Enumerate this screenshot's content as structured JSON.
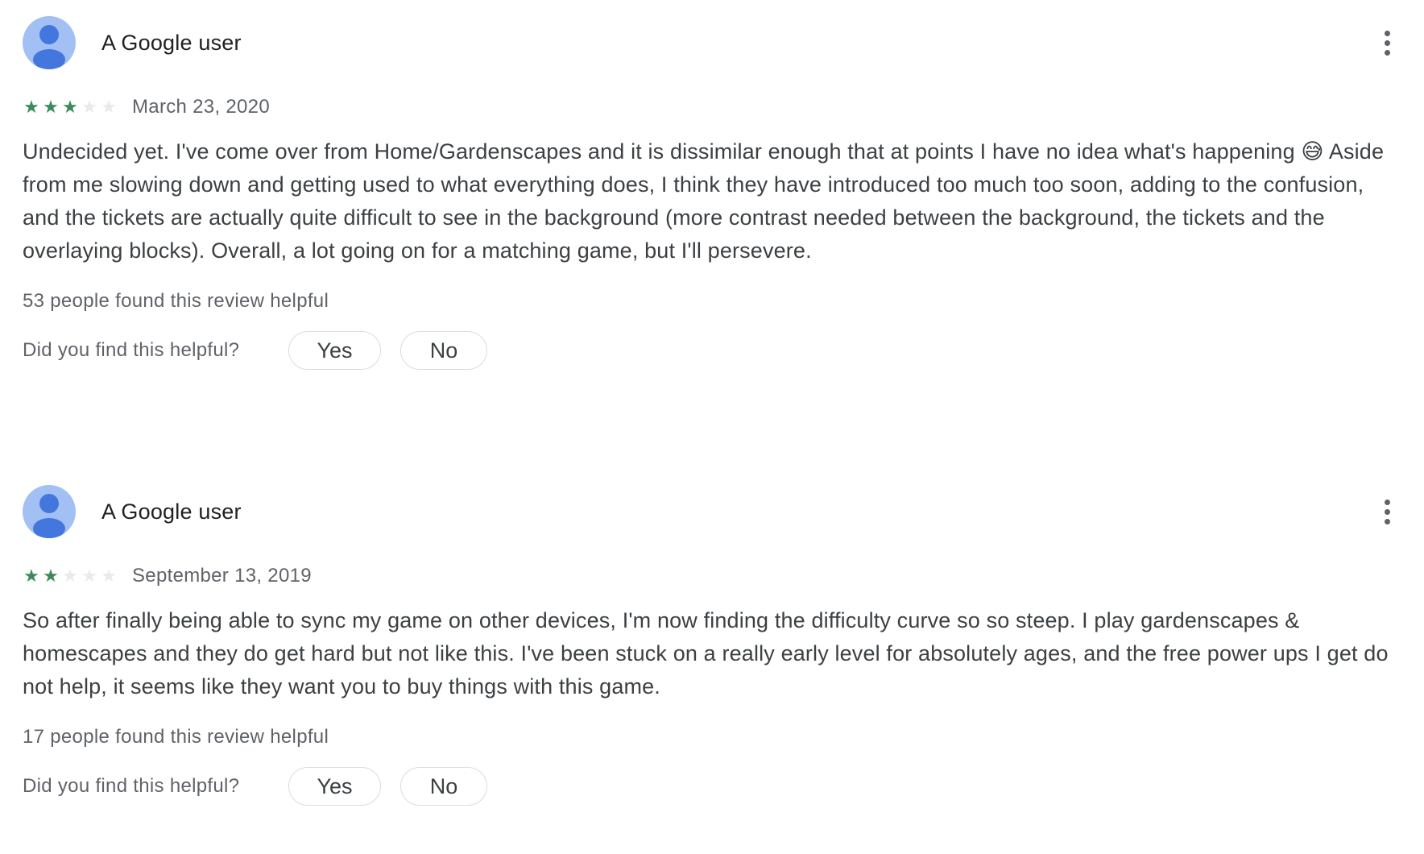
{
  "reviews": [
    {
      "author": "A Google user",
      "rating": 3,
      "max_rating": 5,
      "date": "March 23, 2020",
      "text": "Undecided yet. I've come over from Home/Gardenscapes and it is dissimilar enough that at points I have no idea what's happening 😅 Aside from me slowing down and getting used to what everything does, I think they have introduced too much too soon, adding to the confusion, and the tickets are actually quite difficult to see in the background (more contrast needed between the background, the tickets and the overlaying blocks). Overall, a lot going on for a matching game, but I'll persevere.",
      "helpful_count": "53 people found this review helpful",
      "vote_question": "Did you find this helpful?",
      "yes_label": "Yes",
      "no_label": "No"
    },
    {
      "author": "A Google user",
      "rating": 2,
      "max_rating": 5,
      "date": "September 13, 2019",
      "text": "So after finally being able to sync my game on other devices, I'm now finding the difficulty curve so so steep. I play gardenscapes & homescapes and they do get hard but not like this. I've been stuck on a really early level for absolutely ages, and the free power ups I get do not help, it seems like they want you to buy things with this game.",
      "helpful_count": "17 people found this review helpful",
      "vote_question": "Did you find this helpful?",
      "yes_label": "Yes",
      "no_label": "No"
    }
  ],
  "icons": {
    "avatar": "person-avatar-icon",
    "more": "more-vert-icon",
    "star": "star-icon"
  },
  "colors": {
    "star_on": "#3b8a5a",
    "star_off": "#e8eaed",
    "avatar_bg": "#a3c0f5",
    "avatar_fg": "#4477dd"
  }
}
